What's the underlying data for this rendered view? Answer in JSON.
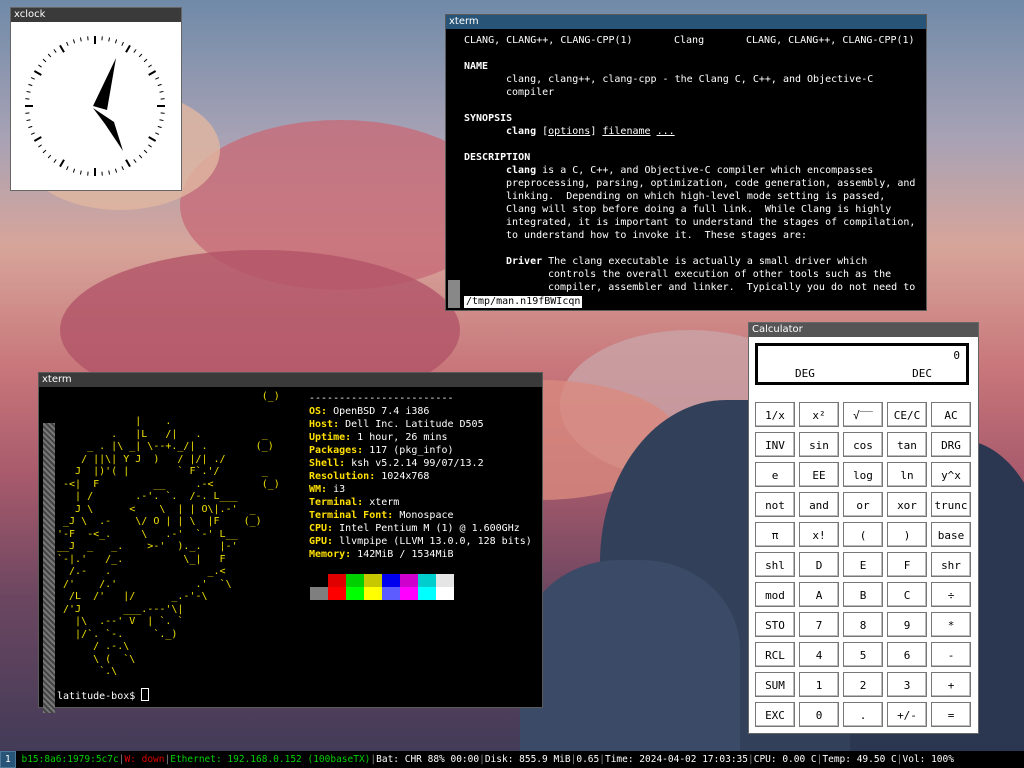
{
  "colors": {
    "focused_titlebar": "#285577",
    "unfocused_titlebar": "#3a3a3a",
    "status_ok": "#00d000",
    "status_bad": "#e00000",
    "neofetch_key": "#ffe000"
  },
  "xclock": {
    "title": "xclock",
    "hour_hand_icon": "clock-hour-hand",
    "minute_hand_icon": "clock-minute-hand"
  },
  "man_xterm": {
    "title": "xterm",
    "header": {
      "left": "CLANG, CLANG++, CLANG-CPP(1)",
      "center": "Clang",
      "right": "CLANG, CLANG++, CLANG-CPP(1)"
    },
    "name_heading": "NAME",
    "name_text_1": "clang, clang++, clang-cpp - the Clang C, C++, and Objective-C",
    "name_text_2": "compiler",
    "synopsis_heading": "SYNOPSIS",
    "synopsis_cmd": "clang",
    "synopsis_options": "options",
    "synopsis_filename": "filename",
    "synopsis_dots": "...",
    "description_heading": "DESCRIPTION",
    "desc_bold": "clang",
    "desc_line_1": " is a C, C++, and Objective-C compiler which encompasses",
    "desc_line_2": "preprocessing, parsing, optimization, code generation, assembly, and",
    "desc_line_3": "linking.  Depending on which high-level mode setting is passed,",
    "desc_line_4": "Clang will stop before doing a full link.  While Clang is highly",
    "desc_line_5": "integrated, it is important to understand the stages of compilation,",
    "desc_line_6": "to understand how to invoke it.  These stages are:",
    "driver_heading": "Driver",
    "driver_line_1": " The clang executable is actually a small driver which",
    "driver_line_2": "controls the overall execution of other tools such as the",
    "driver_line_3": "compiler, assembler and linker.  Typically you do not need to",
    "status": "/tmp/man.n19fBWIcqn"
  },
  "neo_xterm": {
    "title": "xterm",
    "ascii_art": "                                  (_)\n\n             |    .\n         .   |L   /|   .          _\n     _ . |\\ _| \\--+._/| .        (_)\n    / ||\\| Y J  )   / |/| ./\n   J  |)'( |        ` F`.'/       _\n -<|  F         __     .-<        (_)\n   | /       .-'. `.  /-. L___\n   J \\      <    \\  | | O\\|.-'  _\n _J \\  .-    \\/ O | | \\  |F    (_)\n'-F  -<_.     \\   .-'  `-' L__\n__J  _   _.    >-'  )._.   |-'\n`-|.'   /_.          \\_|   F\n  /.-   .                _.<\n /'    /.'             .'  `\\\n  /L  /'   |/      _.-'-\\\n /'J       ___.---'\\|\n   |\\  .--' V  | `. `\n   |/`. `-.     `._)\n      / .-.\\\n      \\ (  `\\\n       `.\\",
    "info_header": "------------------------",
    "info": [
      {
        "key": "OS",
        "value": "OpenBSD 7.4 i386"
      },
      {
        "key": "Host",
        "value": "Dell Inc. Latitude D505"
      },
      {
        "key": "Uptime",
        "value": "1 hour, 26 mins"
      },
      {
        "key": "Packages",
        "value": "117 (pkg_info)"
      },
      {
        "key": "Shell",
        "value": "ksh v5.2.14 99/07/13.2"
      },
      {
        "key": "Resolution",
        "value": "1024x768"
      },
      {
        "key": "WM",
        "value": "i3"
      },
      {
        "key": "Terminal",
        "value": "xterm"
      },
      {
        "key": "Terminal Font",
        "value": "Monospace"
      },
      {
        "key": "CPU",
        "value": "Intel Pentium M (1) @ 1.600GHz"
      },
      {
        "key": "GPU",
        "value": "llvmpipe (LLVM 13.0.0, 128 bits)"
      },
      {
        "key": "Memory",
        "value": "142MiB / 1534MiB"
      }
    ],
    "palette": [
      "#7f7f7f",
      "#e00000",
      "#00d000",
      "#c8c800",
      "#0000ee",
      "#cd00cd",
      "#00cdcd",
      "#e5e5e5",
      "#ff0000",
      "#00ff00",
      "#ffff00",
      "#5c5cff",
      "#ff00ff",
      "#00ffff",
      "#ffffff"
    ],
    "prompt": "latitude-box$ "
  },
  "calculator": {
    "title": "Calculator",
    "display_value": "0",
    "angle_mode": "DEG",
    "base_mode": "DEC",
    "rows": [
      [
        "1/x",
        "x²",
        "√‾‾",
        "CE/C",
        "AC"
      ],
      [
        "INV",
        "sin",
        "cos",
        "tan",
        "DRG"
      ],
      [
        "e",
        "EE",
        "log",
        "ln",
        "y^x"
      ],
      [
        "not",
        "and",
        "or",
        "xor",
        "trunc"
      ],
      [
        "π",
        "x!",
        "(",
        ")",
        "base"
      ],
      [
        "shl",
        "D",
        "E",
        "F",
        "shr"
      ],
      [
        "mod",
        "A",
        "B",
        "C",
        "÷"
      ],
      [
        "STO",
        "7",
        "8",
        "9",
        "*"
      ],
      [
        "RCL",
        "4",
        "5",
        "6",
        "-"
      ],
      [
        "SUM",
        "1",
        "2",
        "3",
        "+"
      ],
      [
        "EXC",
        "0",
        ".",
        "+/-",
        "="
      ]
    ]
  },
  "statusbar": {
    "workspace": "1",
    "ipv6": "b15:8a6:1979:5c7c",
    "wifi": "W: down",
    "ethernet": "Ethernet: 192.168.0.152 (100baseTX)",
    "battery": "Bat: CHR 88% 00:00",
    "disk": "Disk: 855.9 MiB",
    "load": "0.65",
    "time": "Time: 2024-04-02 17:03:35",
    "cpu": "CPU: 0.00 C",
    "temp": "Temp: 49.50 C",
    "volume": "Vol: 100%"
  }
}
